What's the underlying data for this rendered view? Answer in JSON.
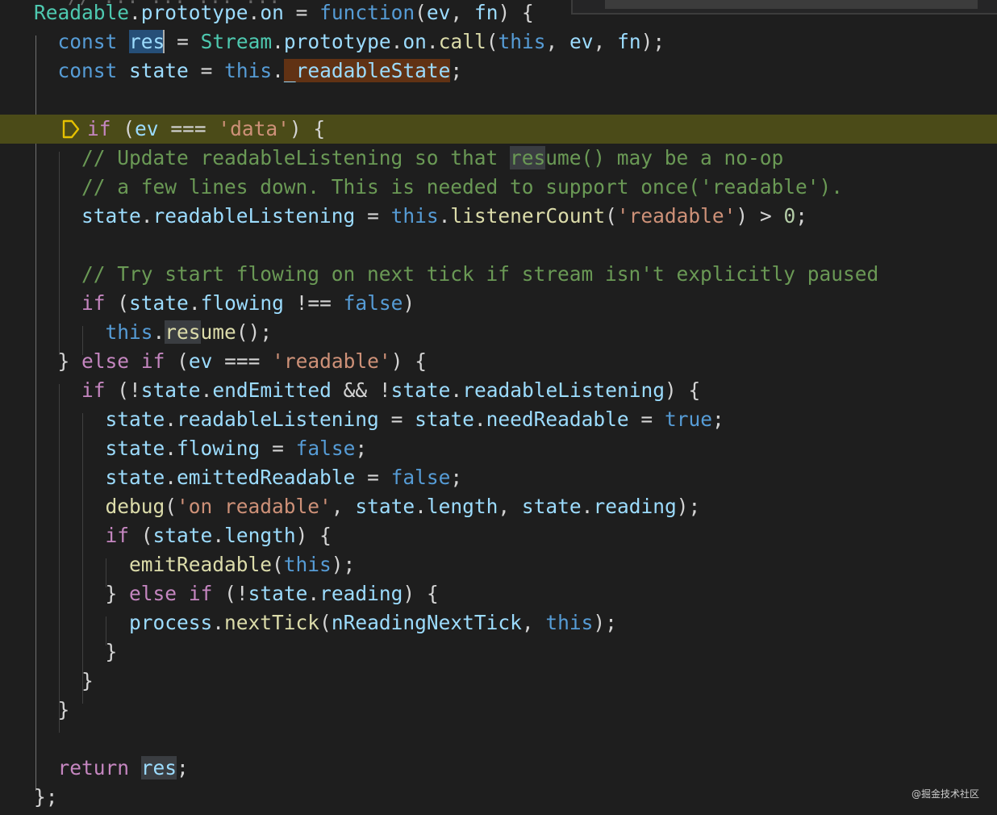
{
  "editor": {
    "partial_top_line": "   // ... ... ... ...",
    "lines": [
      {
        "id": "l1",
        "text": "Readable.prototype.on = function(ev, fn) {"
      },
      {
        "id": "l2",
        "text": "const res = Stream.prototype.on.call(this, ev, fn);"
      },
      {
        "id": "l3",
        "text": "const state = this._readableState;"
      },
      {
        "id": "l4",
        "text": ""
      },
      {
        "id": "l5",
        "text": "if (ev === 'data') {"
      },
      {
        "id": "l6",
        "text": "// Update readableListening so that resume() may be a no-op"
      },
      {
        "id": "l7",
        "text": "// a few lines down. This is needed to support once('readable')."
      },
      {
        "id": "l8",
        "text": "state.readableListening = this.listenerCount('readable') > 0;"
      },
      {
        "id": "l9",
        "text": ""
      },
      {
        "id": "l10",
        "text": "// Try start flowing on next tick if stream isn't explicitly paused"
      },
      {
        "id": "l11",
        "text": "if (state.flowing !== false)"
      },
      {
        "id": "l12",
        "text": "this.resume();"
      },
      {
        "id": "l13",
        "text": "} else if (ev === 'readable') {"
      },
      {
        "id": "l14",
        "text": "if (!state.endEmitted && !state.readableListening) {"
      },
      {
        "id": "l15",
        "text": "state.readableListening = state.needReadable = true;"
      },
      {
        "id": "l16",
        "text": "state.flowing = false;"
      },
      {
        "id": "l17",
        "text": "state.emittedReadable = false;"
      },
      {
        "id": "l18",
        "text": "debug('on readable', state.length, state.reading);"
      },
      {
        "id": "l19",
        "text": "if (state.length) {"
      },
      {
        "id": "l20",
        "text": "emitReadable(this);"
      },
      {
        "id": "l21",
        "text": "} else if (!state.reading) {"
      },
      {
        "id": "l22",
        "text": "process.nextTick(nReadingNextTick, this);"
      },
      {
        "id": "l23",
        "text": "}"
      },
      {
        "id": "l24",
        "text": "}"
      },
      {
        "id": "l25",
        "text": "}"
      },
      {
        "id": "l26",
        "text": ""
      },
      {
        "id": "l27",
        "text": "return res;"
      },
      {
        "id": "l28",
        "text": "};"
      }
    ],
    "current_line_color": "#4b4b18",
    "breakpoint_icon": "conditional-breakpoint-icon",
    "breakpoint_color": "#e5c100"
  },
  "theme": {
    "background": "#1e1e1e",
    "keyword": "#569cd6",
    "control": "#c586c0",
    "class": "#4ec9b0",
    "function": "#dcdcaa",
    "variable": "#9cdcfe",
    "string": "#ce9178",
    "number": "#b5cea8",
    "comment": "#6a9955"
  },
  "watermark": "@掘金技术社区"
}
